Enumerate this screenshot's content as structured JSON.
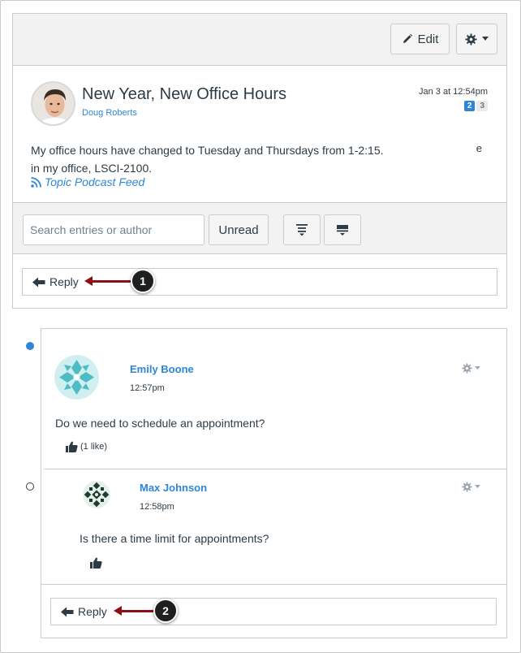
{
  "toolbar": {
    "edit_label": "Edit"
  },
  "topic": {
    "title": "New Year, New Office Hours",
    "author": "Doug Roberts",
    "date": "Jan 3 at 12:54pm",
    "unread_count": "2",
    "total_count": "3",
    "body_line1": "My office hours have changed to Tuesday and Thursdays from 1-2:15.",
    "body_line2": "in my office, LSCI-2100.",
    "stray_char": "e",
    "podcast_label": "Topic Podcast Feed"
  },
  "search": {
    "placeholder": "Search entries or author",
    "unread_label": "Unread"
  },
  "reply": {
    "label": "Reply"
  },
  "callouts": {
    "first": "1",
    "second": "2"
  },
  "entries": [
    {
      "author": "Emily Boone",
      "time": "12:57pm",
      "text": "Do we need to schedule an appointment?",
      "likes": "(1 like)"
    },
    {
      "author": "Max Johnson",
      "time": "12:58pm",
      "text": "Is there a time limit for appointments?"
    }
  ],
  "colors": {
    "link": "#2d86d6",
    "annotation_arrow": "#8b0f14",
    "unread_dot": "#2d86d6"
  }
}
